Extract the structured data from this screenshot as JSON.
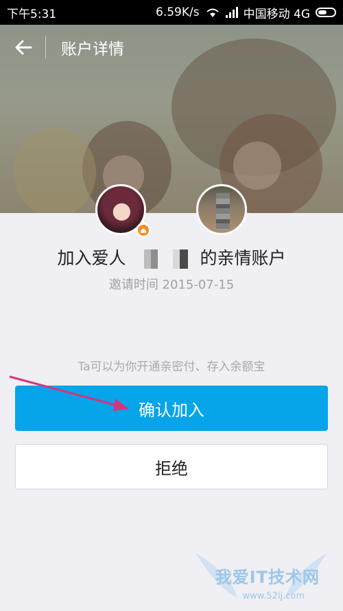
{
  "status_bar": {
    "time": "下午5:31",
    "speed": "6.59K/s",
    "carrier": "中国移动 4G"
  },
  "header": {
    "title": "账户详情",
    "back_icon": "back-arrow-icon"
  },
  "invite": {
    "headline_prefix": "加入爱人",
    "headline_suffix": "的亲情账户",
    "time_text": "邀请时间 2015-07-15"
  },
  "hint": "Ta可以为你开通亲密付、存入余额宝",
  "actions": {
    "confirm_label": "确认加入",
    "reject_label": "拒绝"
  },
  "colors": {
    "accent": "#06a4e9",
    "annotation_arrow": "#d4357f"
  },
  "watermark": {
    "title": "我爱IT技术网",
    "url": "www.52ij.com"
  }
}
